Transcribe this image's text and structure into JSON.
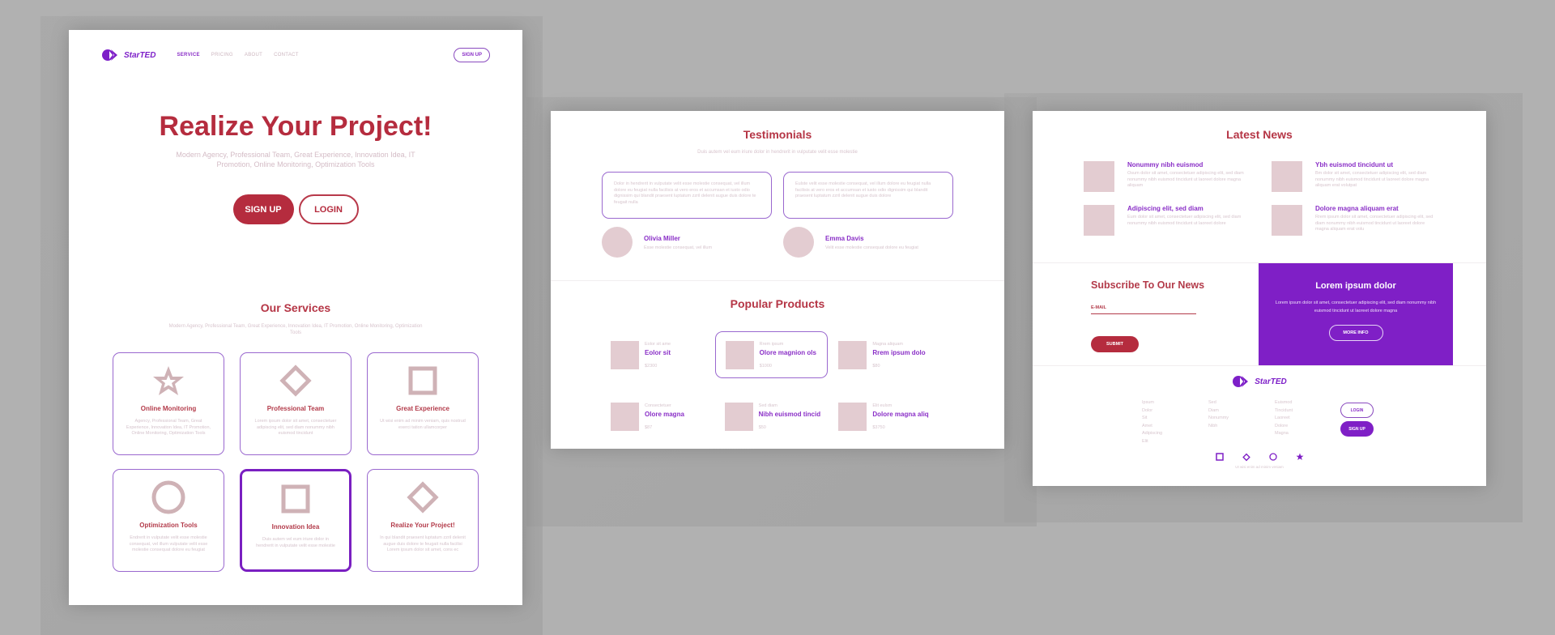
{
  "colors": {
    "background": "#b1b1b1",
    "accent_red": "#b52c3e",
    "accent_purple": "#7f1fc6",
    "card_border": "#9a68cf",
    "thumb_placeholder": "#e3ccd1",
    "muted_text": "#d7c5cd"
  },
  "panel1": {
    "logo_text": "StarTED",
    "nav": [
      "SERVICE",
      "PRICING",
      "ABOUT",
      "CONTACT"
    ],
    "nav_active": "SERVICE",
    "signup_label": "SIGN UP",
    "hero": {
      "title": "Realize Your Project!",
      "subtitle": "Modern Agency, Professional Team, Great Experience, Innovation Idea, IT Promotion, Online Monitoring, Optimization Tools",
      "primary_button": "SIGN UP",
      "secondary_button": "LOGIN"
    },
    "services": {
      "title": "Our Services",
      "subtitle": "Modern Agency, Professional Team, Great Experience, Innovation Idea, IT Promotion, Online Monitoring, Optimization Tools",
      "items": [
        {
          "icon": "star-icon",
          "title": "Online Monitoring",
          "desc": "Agency, Professional Team, Great Experience, Innovation Idea, IT Promotion, Online Monitoring, Optimization Tools"
        },
        {
          "icon": "diamond-icon",
          "title": "Professional Team",
          "desc": "Lorem ipsum dolor sit amet, consectetuer adipiscing elit, sed diam nonummy nibh euismod tincidunt"
        },
        {
          "icon": "square-icon",
          "title": "Great Experience",
          "desc": "Ut wisi enim ad minim veniam, quis nostrud exerci tation ullamcorper"
        },
        {
          "icon": "circle-icon",
          "title": "Optimization Tools",
          "desc": "Endrerit in vulputate velit esse molestie consequat, vel illum vulputate velit esse molestie consequat dolore eu feugiat"
        },
        {
          "icon": "square-icon",
          "title": "Innovation Idea",
          "desc": "Duis autem vel eum iriure dolor in hendrerit in vulputate velit esse molestie"
        },
        {
          "icon": "diamond-icon",
          "title": "Realize Your Project!",
          "desc": "In qui blandit praesent luptatum zzril delenit augue duis dolore te feugait nulla facilisi Lorem ipsum dolor sit amet, cons ec"
        }
      ],
      "active_index": 4
    }
  },
  "panel2": {
    "testimonials": {
      "title": "Testimonials",
      "subtitle": "Duis autem vel eum iriure dolor in hendrerit in vulputate velit esse molestie",
      "items": [
        {
          "quote": "Dolor in hendrerit in vulputate velit esse molestie consequat, vel illum dolore eu feugiat nulla facilisis at vero eros et accumsan et iusto odio dignissim qui blandit praesent luptatum zzril delenit augue duis dolore te feugait nulla",
          "name": "Olivia Miller",
          "role": "Esse molestie consequat, vel illum"
        },
        {
          "quote": "Eulste velit esse molestie consequat, vel illum dolore eu feugiat nulla facilisis at vero eros et accumsan et iusto odio dignissim qui blandit praesent luptatum zzril delenit augue duis dolore",
          "name": "Emma Davis",
          "role": "Velit esse molestie consequat dolore eu feugiat"
        }
      ]
    },
    "products": {
      "title": "Popular Products",
      "items": [
        {
          "category": "Eolor sit ame",
          "name": "Eolor sit",
          "price": "$2300"
        },
        {
          "category": "Rrem ipsum",
          "name": "Olore magnion ols",
          "price": "$1000"
        },
        {
          "category": "Magna aliquam",
          "name": "Rrem ipsum dolo",
          "price": "$80"
        },
        {
          "category": "Consectetuer",
          "name": "Olore magna",
          "price": "$87"
        },
        {
          "category": "Sed diam",
          "name": "Nibh euismod tincid",
          "price": "$50"
        },
        {
          "category": "Elit eulsm",
          "name": "Dolore magna aliq",
          "price": "$3750"
        }
      ],
      "active_index": 1
    }
  },
  "panel3": {
    "news": {
      "title": "Latest News",
      "items": [
        {
          "title": "Nonummy nibh euismod",
          "text": "Osum dolor sit amet, consectetuer adipiscing elit, sed diam nonummy nibh euismod tincidunt ut laoreet dolore magna aliquam"
        },
        {
          "title": "Ybh euismod tincidunt ut",
          "text": "Bm dolor sit amet, consectetuer adipiscing elit, sed diam nonummy nibh euismod tincidunt ut laoreet dolore magna aliquam erat volutpat"
        },
        {
          "title": "Adipiscing elit, sed diam",
          "text": "Eum dolor sit amet, consectetuer adipiscing elit, sed diam nonummy nibh euismod tincidunt ut laoreet dolore"
        },
        {
          "title": "Dolore magna aliquam erat",
          "text": "Rrem ipsum dolor sit amet, consectetuer adipiscing elit, sed diam nonummy nibh euismod tincidunt ut laoreet dolore magna aliquam erat volu"
        }
      ]
    },
    "subscribe": {
      "title": "Subscribe To Our News",
      "email_label": "E-MAIL",
      "email_value": "",
      "submit_label": "SUBMIT"
    },
    "promo": {
      "title": "Lorem ipsum dolor",
      "text": "Lorem ipsum dolor sit amet, consectetuer adipiscing elit, sed diam nonummy nibh euismod tincidunt ut laoreet dolore magna",
      "button": "MORE INFO"
    },
    "footer": {
      "logo_text": "StarTED",
      "columns": [
        [
          "Ipsum",
          "Dolor",
          "Sit",
          "Amet",
          "Adipiscing",
          "Elit"
        ],
        [
          "Sed",
          "Diam",
          "Nonummy",
          "Nibh"
        ],
        [
          "Euismod",
          "Tincidunt",
          "Laoreet",
          "Dolore",
          "Magna"
        ]
      ],
      "login_label": "LOGIN",
      "signup_label": "SIGN UP",
      "icons": [
        "square-icon",
        "diamond-icon",
        "circle-icon",
        "star-icon"
      ],
      "note": "Ut wisi enim ad minim veniam"
    }
  }
}
